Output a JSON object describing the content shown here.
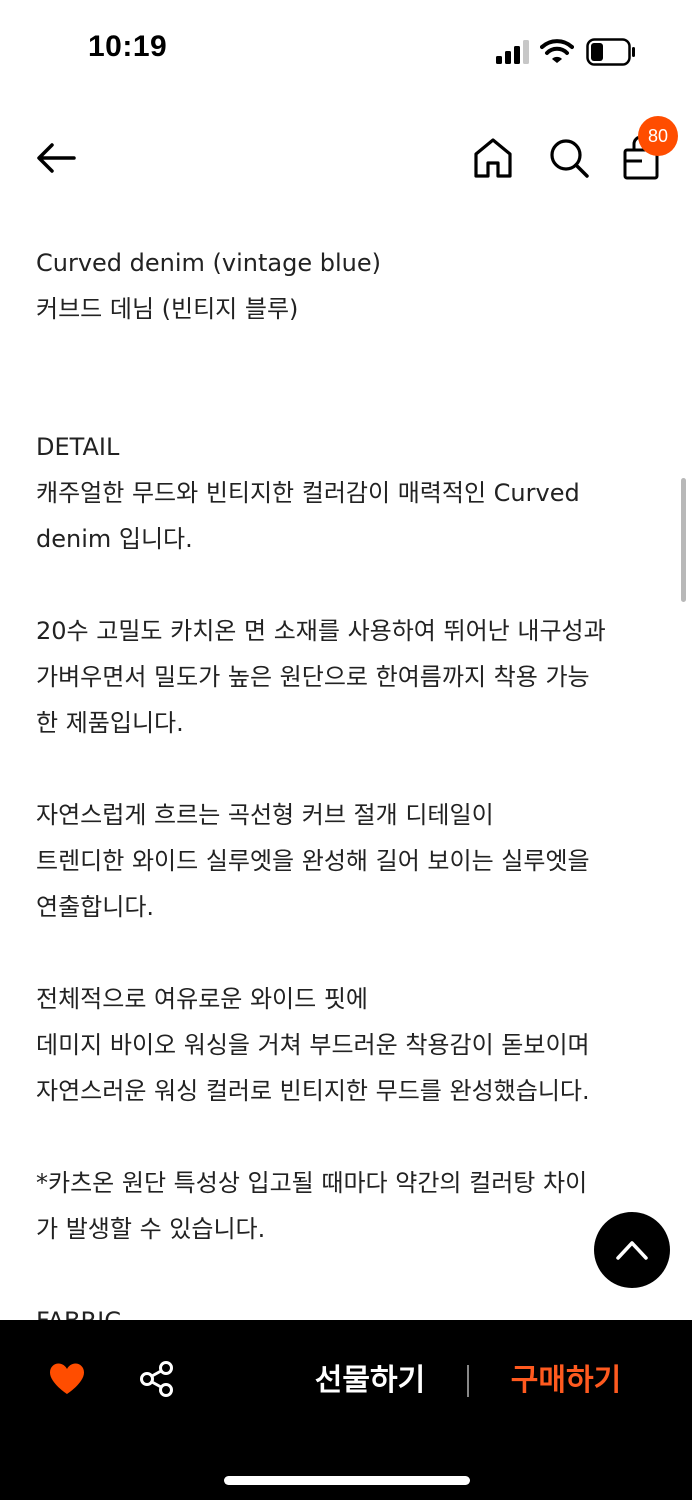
{
  "status_bar": {
    "time": "10:19"
  },
  "nav": {
    "cart_count": "80"
  },
  "product": {
    "title_en": "Curved denim (vintage blue)",
    "title_ko": "커브드 데님 (빈티지 블루)"
  },
  "detail": {
    "heading": "DETAIL",
    "p1": [
      "캐주얼한 무드와 빈티지한 컬러감이 매력적인 Curved",
      "denim 입니다."
    ],
    "p2": [
      "20수 고밀도 카치온 면 소재를 사용하여 뛰어난 내구성과",
      "가벼우면서 밀도가 높은 원단으로 한여름까지 착용 가능",
      "한 제품입니다."
    ],
    "p3": [
      "자연스럽게 흐르는 곡선형 커브 절개 디테일이",
      "트렌디한 와이드 실루엣을 완성해 길어 보이는 실루엣을",
      "연출합니다."
    ],
    "p4": [
      "전체적으로 여유로운 와이드 핏에",
      "데미지 바이오 워싱을 거쳐 부드러운 착용감이 돋보이며",
      "자연스러운 워싱 컬러로 빈티지한 무드를 완성했습니다."
    ],
    "p5": [
      "*카츠온 원단 특성상 입고될 때마다 약간의 컬러탕 차이",
      "가 발생할 수 있습니다."
    ],
    "next_heading": "FABRIC"
  },
  "bottom_bar": {
    "gift_label": "선물하기",
    "buy_label": "구매하기"
  },
  "colors": {
    "accent": "#ff4d00",
    "buy": "#ff5a1f",
    "bar": "#000000"
  },
  "icons": [
    "signal-icon",
    "wifi-icon",
    "battery-icon",
    "back-arrow-icon",
    "home-icon",
    "search-icon",
    "cart-icon",
    "chevron-up-icon",
    "heart-icon",
    "share-icon"
  ]
}
